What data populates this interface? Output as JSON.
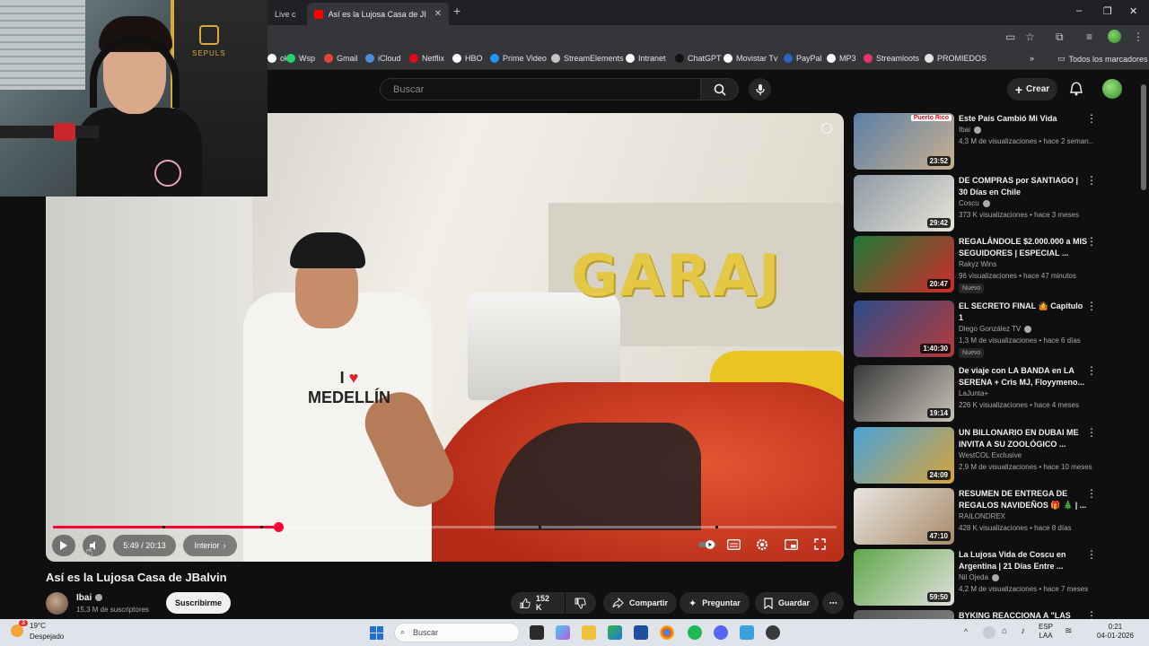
{
  "browser": {
    "tabs": [
      {
        "label": "Live c"
      },
      {
        "label": "Así es la Lujosa Casa de JBalvin"
      }
    ],
    "new_tab": "+",
    "win_min": "–",
    "win_max": "❐",
    "win_close": "✕"
  },
  "bookmarks": [
    {
      "label": "ok",
      "color": "#ffffff"
    },
    {
      "label": "Wsp",
      "color": "#25d366"
    },
    {
      "label": "Gmail",
      "color": "#ea4335"
    },
    {
      "label": "iCloud",
      "color": "#4a90d9"
    },
    {
      "label": "Netflix",
      "color": "#e50914"
    },
    {
      "label": "HBO",
      "color": "#ffffff"
    },
    {
      "label": "Prime Video",
      "color": "#1a98ff"
    },
    {
      "label": "StreamElements",
      "color": "#c4c4c4"
    },
    {
      "label": "Intranet",
      "color": "#ffffff"
    },
    {
      "label": "ChatGPT",
      "color": "#111111"
    },
    {
      "label": "Movistar Tv",
      "color": "#ffffff"
    },
    {
      "label": "PayPal",
      "color": "#2a64c5"
    },
    {
      "label": "MP3",
      "color": "#ffffff"
    },
    {
      "label": "Streamloots",
      "color": "#e8336d"
    },
    {
      "label": "PROMIEDOS",
      "color": "#e3e3e3"
    }
  ],
  "bookmarks_more": "»",
  "bookmarks_all": "Todos los marcadores",
  "yt": {
    "search_placeholder": "Buscar",
    "create_label": "Crear"
  },
  "player": {
    "overlay_text": "GARAJ",
    "shirt_line1": "I",
    "shirt_heart": "♥",
    "shirt_line2": "MEDELLÍN",
    "time": "5:49 / 20:13",
    "chapter": "Interior",
    "progress": 0.288,
    "chapter_marks": [
      0.14,
      0.265,
      0.62,
      0.845
    ]
  },
  "video": {
    "title": "Así es la Lujosa Casa de JBalvin",
    "channel": "Ibai",
    "subscribers": "15,3 M de suscriptores",
    "subscribe_label": "Suscribirme",
    "likes": "152 K",
    "share_label": "Compartir",
    "ask_label": "Preguntar",
    "save_label": "Guardar"
  },
  "webcam": {
    "chair_brand": "SEPULS"
  },
  "recommendations": [
    {
      "title": "Este País Cambió Mi Vida",
      "channel": "Ibai",
      "verified": true,
      "meta": "4,3 M de visualizaciones • hace 2 seman...",
      "duration": "23:52",
      "badge": "",
      "thumb_tag": "Puerto Rico",
      "thumb": [
        "#5a7fa8",
        "#c9b08f"
      ]
    },
    {
      "title": "DE COMPRAS por SANTIAGO | 30 Días en Chile",
      "channel": "Coscu",
      "verified": true,
      "meta": "373 K visualizaciones • hace 3 meses",
      "duration": "29:42",
      "badge": "",
      "thumb_tag": "",
      "thumb": [
        "#8e9aa6",
        "#e8e4d8"
      ]
    },
    {
      "title": "REGALÁNDOLE $2.000.000 a MIS SEGUIDORES | ESPECIAL ...",
      "channel": "Rakyz Wins",
      "verified": false,
      "meta": "96 visualizaciones • hace 47 minutos",
      "duration": "20:47",
      "badge": "Nuevo",
      "thumb_tag": "",
      "thumb": [
        "#1f7a36",
        "#d02a2a"
      ]
    },
    {
      "title": "EL SECRETO FINAL 🤷 Capítulo 1",
      "channel": "Diego González TV",
      "verified": true,
      "meta": "1,3 M de visualizaciones • hace 6 días",
      "duration": "1:40:30",
      "badge": "Nuevo",
      "thumb_tag": "",
      "thumb": [
        "#2b4c8a",
        "#b63a3a"
      ]
    },
    {
      "title": "De viaje con LA BANDA en LA SERENA + Cris MJ, Floyymeno...",
      "channel": "LaJunta+",
      "verified": false,
      "meta": "226 K visualizaciones • hace 4 meses",
      "duration": "19:14",
      "badge": "",
      "thumb_tag": "",
      "thumb": [
        "#3a3a3a",
        "#c8c2b8"
      ]
    },
    {
      "title": "UN BILLONARIO EN DUBAI ME INVITA A SU ZOOLÓGICO ...",
      "channel": "WestCOL Exclusive",
      "verified": false,
      "meta": "2,9 M de visualizaciones • hace 10 meses",
      "duration": "24:09",
      "badge": "",
      "thumb_tag": "",
      "thumb": [
        "#4aa3d8",
        "#d8a33a"
      ]
    },
    {
      "title": "RESUMEN DE ENTREGA DE REGALOS NAVIDEÑOS 🎁 🎄 | ...",
      "channel": "RAILONDREX",
      "verified": false,
      "meta": "428 K visualizaciones • hace 8 días",
      "duration": "47:10",
      "badge": "",
      "thumb_tag": "",
      "thumb": [
        "#e8e6e0",
        "#a88a6a"
      ]
    },
    {
      "title": "La Lujosa Vida de Coscu en Argentina | 21 Días Entre ...",
      "channel": "Nil Ojeda",
      "verified": true,
      "meta": "4,2 M de visualizaciones • hace 7 meses",
      "duration": "59:50",
      "badge": "",
      "thumb_tag": "",
      "thumb": [
        "#5fa84a",
        "#e0e0dc"
      ]
    },
    {
      "title": "BYKING REACCIONA A \"LAS",
      "channel": "",
      "verified": false,
      "meta": "",
      "duration": "",
      "badge": "",
      "thumb_tag": "",
      "thumb": [
        "#555555",
        "#888888"
      ]
    }
  ],
  "taskbar": {
    "temp": "19°C",
    "weather": "Despejado",
    "weather_badge": "3",
    "search": "Buscar",
    "lang1": "ESP",
    "lang2": "LAA",
    "time": "0:21",
    "date": "04-01-2026"
  }
}
